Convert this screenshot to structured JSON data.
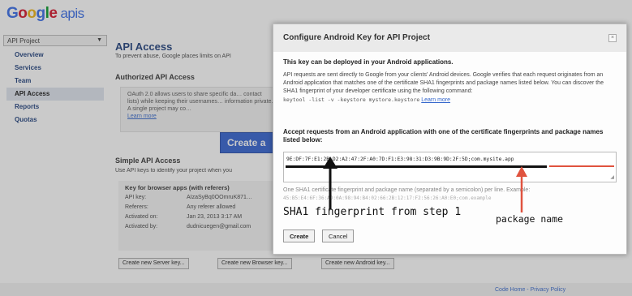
{
  "header": {
    "logo_word": "Google",
    "logo_suffix": "apis"
  },
  "project_select": {
    "value": "API Project"
  },
  "sidebar": {
    "items": [
      {
        "label": "Overview"
      },
      {
        "label": "Services"
      },
      {
        "label": "Team"
      },
      {
        "label": "API Access",
        "active": true
      },
      {
        "label": "Reports"
      },
      {
        "label": "Quotas"
      }
    ]
  },
  "main": {
    "title": "API Access",
    "subtitle": "To prevent abuse, Google places limits on API",
    "authorized_heading": "Authorized API Access",
    "oauth_text": "OAuth 2.0 allows users to share specific da… contact lists) while keeping their usernames… information private. A single project may co…",
    "learn_more": "Learn more",
    "create_button": "Create a",
    "simple_heading": "Simple API Access",
    "simple_subtitle": "Use API keys to identify your project when you",
    "key_box": {
      "heading": "Key for browser apps (with referers)",
      "rows": [
        {
          "key": "API key:",
          "value": "AIzaSyBq0OOmruK871…"
        },
        {
          "key": "Referers:",
          "value": "Any referer allowed"
        },
        {
          "key": "Activated on:",
          "value": "Jan 23, 2013 3:17 AM"
        },
        {
          "key": "Activated by:",
          "value": "dudnicuegen@gmail.com"
        }
      ]
    },
    "key_buttons": {
      "server": "Create new Server key...",
      "browser": "Create new Browser key...",
      "android": "Create new Android key..."
    }
  },
  "footer": {
    "links": "Code Home - Privacy Policy"
  },
  "dialog": {
    "title": "Configure Android Key for API Project",
    "close_glyph": "×",
    "lead": "This key can be deployed in your Android applications.",
    "description": "API requests are sent directly to Google from your clients' Android devices. Google verifies that each request originates from an Android application that matches one of the certificate SHA1 fingerprints and package names listed below. You can discover the SHA1 fingerprint of your developer certificate using the following command:",
    "command": "keytool -list -v -keystore mystore.keystore",
    "learn_more": "Learn more",
    "accept_heading": "Accept requests from an Android application with one of the certificate fingerprints and package names listed below:",
    "fingerprint_value": "9E:DF:7F:E1:2B:D2:A2:47:2F:A0:7D:F1:E3:98:31:D3:9B:9D:2F:5D;com.mysite.app",
    "hint": "One SHA1 certificate fingerprint and package name (separated by a semicolon) per line. Example:",
    "hint_example": "45:B5:E4:6F:36:AD:0A:98:94:B4:02:66:2B:12:17:F2:56:26:A0:E0;com.example",
    "annotation_sha1": "SHA1 fingerprint from step 1",
    "annotation_package": "package name",
    "buttons": {
      "create": "Create",
      "cancel": "Cancel"
    }
  },
  "colors": {
    "accent": "#2f5fd0",
    "annotation_arrow_black": "#111111",
    "annotation_arrow_red": "#e0533f",
    "link": "#3366cc"
  }
}
